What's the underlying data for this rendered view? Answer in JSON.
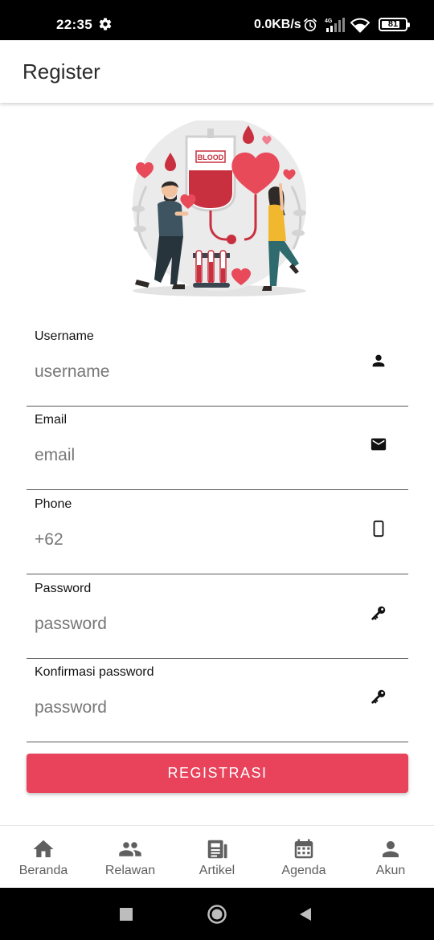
{
  "status_bar": {
    "time": "22:35",
    "net_speed": "0.0KB/s",
    "network_type": "4G",
    "battery_level": "81",
    "icons": [
      "gear-icon",
      "alarm-icon",
      "signal-icon",
      "wifi-icon",
      "battery-icon"
    ]
  },
  "app_bar": {
    "title": "Register"
  },
  "illustration": {
    "bag_text": "BLOOD"
  },
  "form": {
    "username": {
      "label": "Username",
      "placeholder": "username",
      "value": "",
      "icon": "person-icon"
    },
    "email": {
      "label": "Email",
      "placeholder": "email",
      "value": "",
      "icon": "mail-icon"
    },
    "phone": {
      "label": "Phone",
      "placeholder": "+62",
      "value": "",
      "icon": "smartphone-icon"
    },
    "password": {
      "label": "Password",
      "placeholder": "password",
      "value": "",
      "icon": "key-icon"
    },
    "confirm_password": {
      "label": "Konfirmasi password",
      "placeholder": "password",
      "value": "",
      "icon": "key-icon"
    },
    "submit_label": "REGISTRASI"
  },
  "bottom_nav": {
    "items": [
      {
        "label": "Beranda",
        "icon": "home-icon"
      },
      {
        "label": "Relawan",
        "icon": "group-icon"
      },
      {
        "label": "Artikel",
        "icon": "article-icon"
      },
      {
        "label": "Agenda",
        "icon": "calendar-icon"
      },
      {
        "label": "Akun",
        "icon": "person-icon"
      }
    ]
  },
  "colors": {
    "accent": "#e8435b",
    "status_bar_bg": "#000000",
    "nav_icon": "#5f5f5f"
  }
}
